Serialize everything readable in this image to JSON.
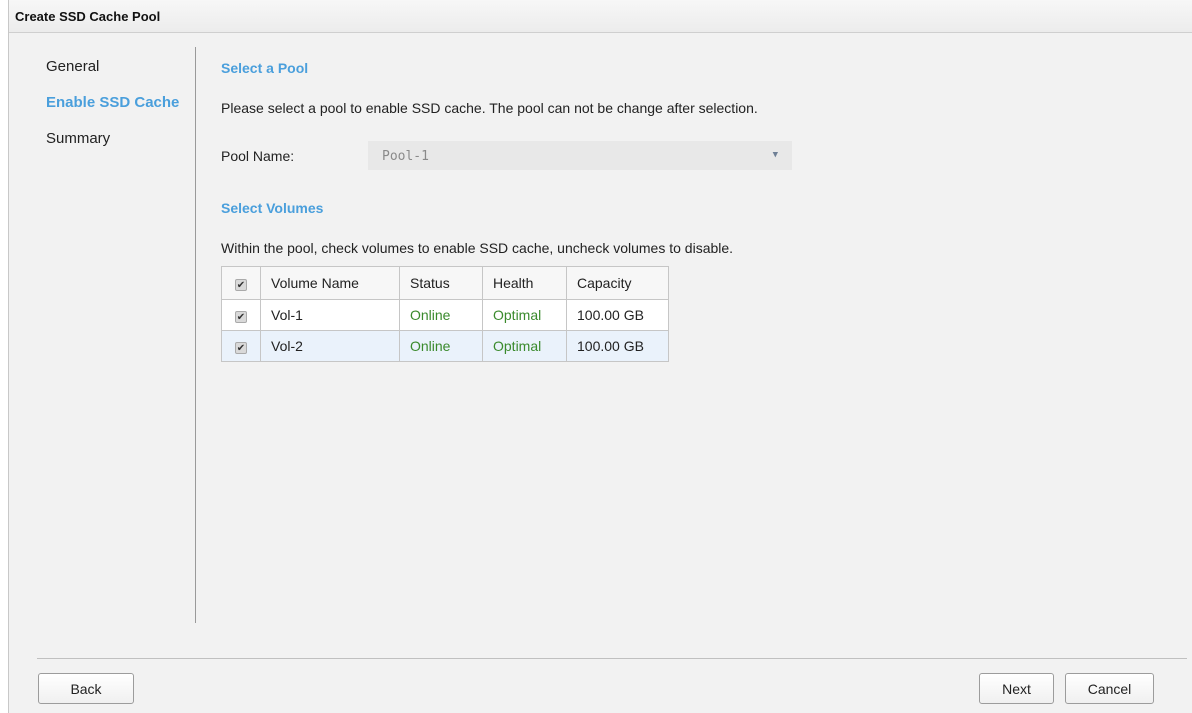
{
  "dialog": {
    "title": "Create SSD Cache Pool"
  },
  "nav": {
    "items": [
      {
        "label": "General",
        "active": false
      },
      {
        "label": "Enable SSD Cache",
        "active": true
      },
      {
        "label": "Summary",
        "active": false
      }
    ]
  },
  "pool_section": {
    "title": "Select a Pool",
    "description": "Please select a pool to enable SSD cache. The pool can not be change after selection.",
    "pool_label": "Pool Name:",
    "pool_value": "Pool-1"
  },
  "volumes_section": {
    "title": "Select Volumes",
    "description": "Within the pool, check volumes to enable SSD cache, uncheck volumes to disable.",
    "header_checked": true,
    "columns": [
      "Volume Name",
      "Status",
      "Health",
      "Capacity"
    ],
    "rows": [
      {
        "checked": true,
        "name": "Vol-1",
        "status": "Online",
        "health": "Optimal",
        "capacity": "100.00 GB"
      },
      {
        "checked": true,
        "name": "Vol-2",
        "status": "Online",
        "health": "Optimal",
        "capacity": "100.00 GB"
      }
    ]
  },
  "buttons": {
    "back": "Back",
    "next": "Next",
    "cancel": "Cancel"
  },
  "colors": {
    "accent": "#4a9fdc",
    "status_green": "#3a8a2c",
    "row_alt": "#eaf2fb"
  }
}
